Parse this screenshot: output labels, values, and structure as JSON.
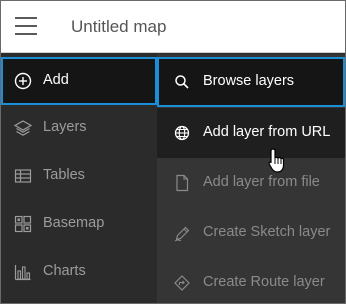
{
  "header": {
    "title": "Untitled map",
    "menu_icon": "hamburger-menu-icon"
  },
  "sidebar": {
    "items": [
      {
        "label": "Add",
        "icon": "plus-circle-icon",
        "active": true
      },
      {
        "label": "Layers",
        "icon": "layers-icon"
      },
      {
        "label": "Tables",
        "icon": "table-icon"
      },
      {
        "label": "Basemap",
        "icon": "basemap-grid-icon"
      },
      {
        "label": "Charts",
        "icon": "bar-chart-icon"
      }
    ]
  },
  "submenu": {
    "items": [
      {
        "label": "Browse layers",
        "icon": "search-icon",
        "state": "selected"
      },
      {
        "label": "Add layer from URL",
        "icon": "globe-icon",
        "state": "hover"
      },
      {
        "label": "Add layer from file",
        "icon": "file-icon"
      },
      {
        "label": "Create Sketch layer",
        "icon": "pencil-icon"
      },
      {
        "label": "Create Route layer",
        "icon": "route-icon"
      }
    ]
  },
  "colors": {
    "accent": "#1a8fd8",
    "sidebar_bg": "#2b2b2b",
    "submenu_bg": "#353535",
    "active_bg": "#151515"
  }
}
